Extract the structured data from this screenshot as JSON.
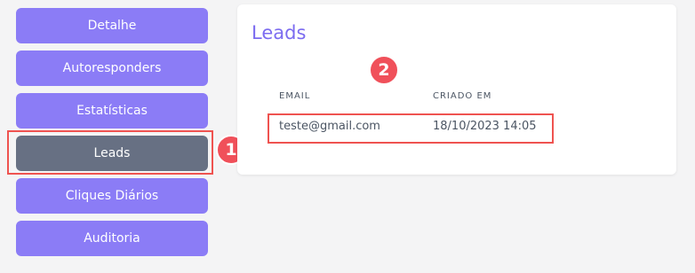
{
  "sidebar": {
    "items": [
      {
        "label": "Detalhe"
      },
      {
        "label": "Autoresponders"
      },
      {
        "label": "Estatísticas"
      },
      {
        "label": "Leads"
      },
      {
        "label": "Cliques Diários"
      },
      {
        "label": "Auditoria"
      }
    ]
  },
  "annotations": {
    "badge_1": "1",
    "badge_2": "2"
  },
  "leads_card": {
    "title": "Leads",
    "columns": [
      "EMAIL",
      "CRIADO EM"
    ],
    "rows": [
      {
        "email": "teste@gmail.com",
        "criado_em": "18/10/2023 14:05"
      }
    ]
  },
  "colors": {
    "nav_button": "#8b7cf6",
    "nav_button_active": "#677083",
    "highlight": "#ef5350",
    "title": "#7c6cf0"
  }
}
